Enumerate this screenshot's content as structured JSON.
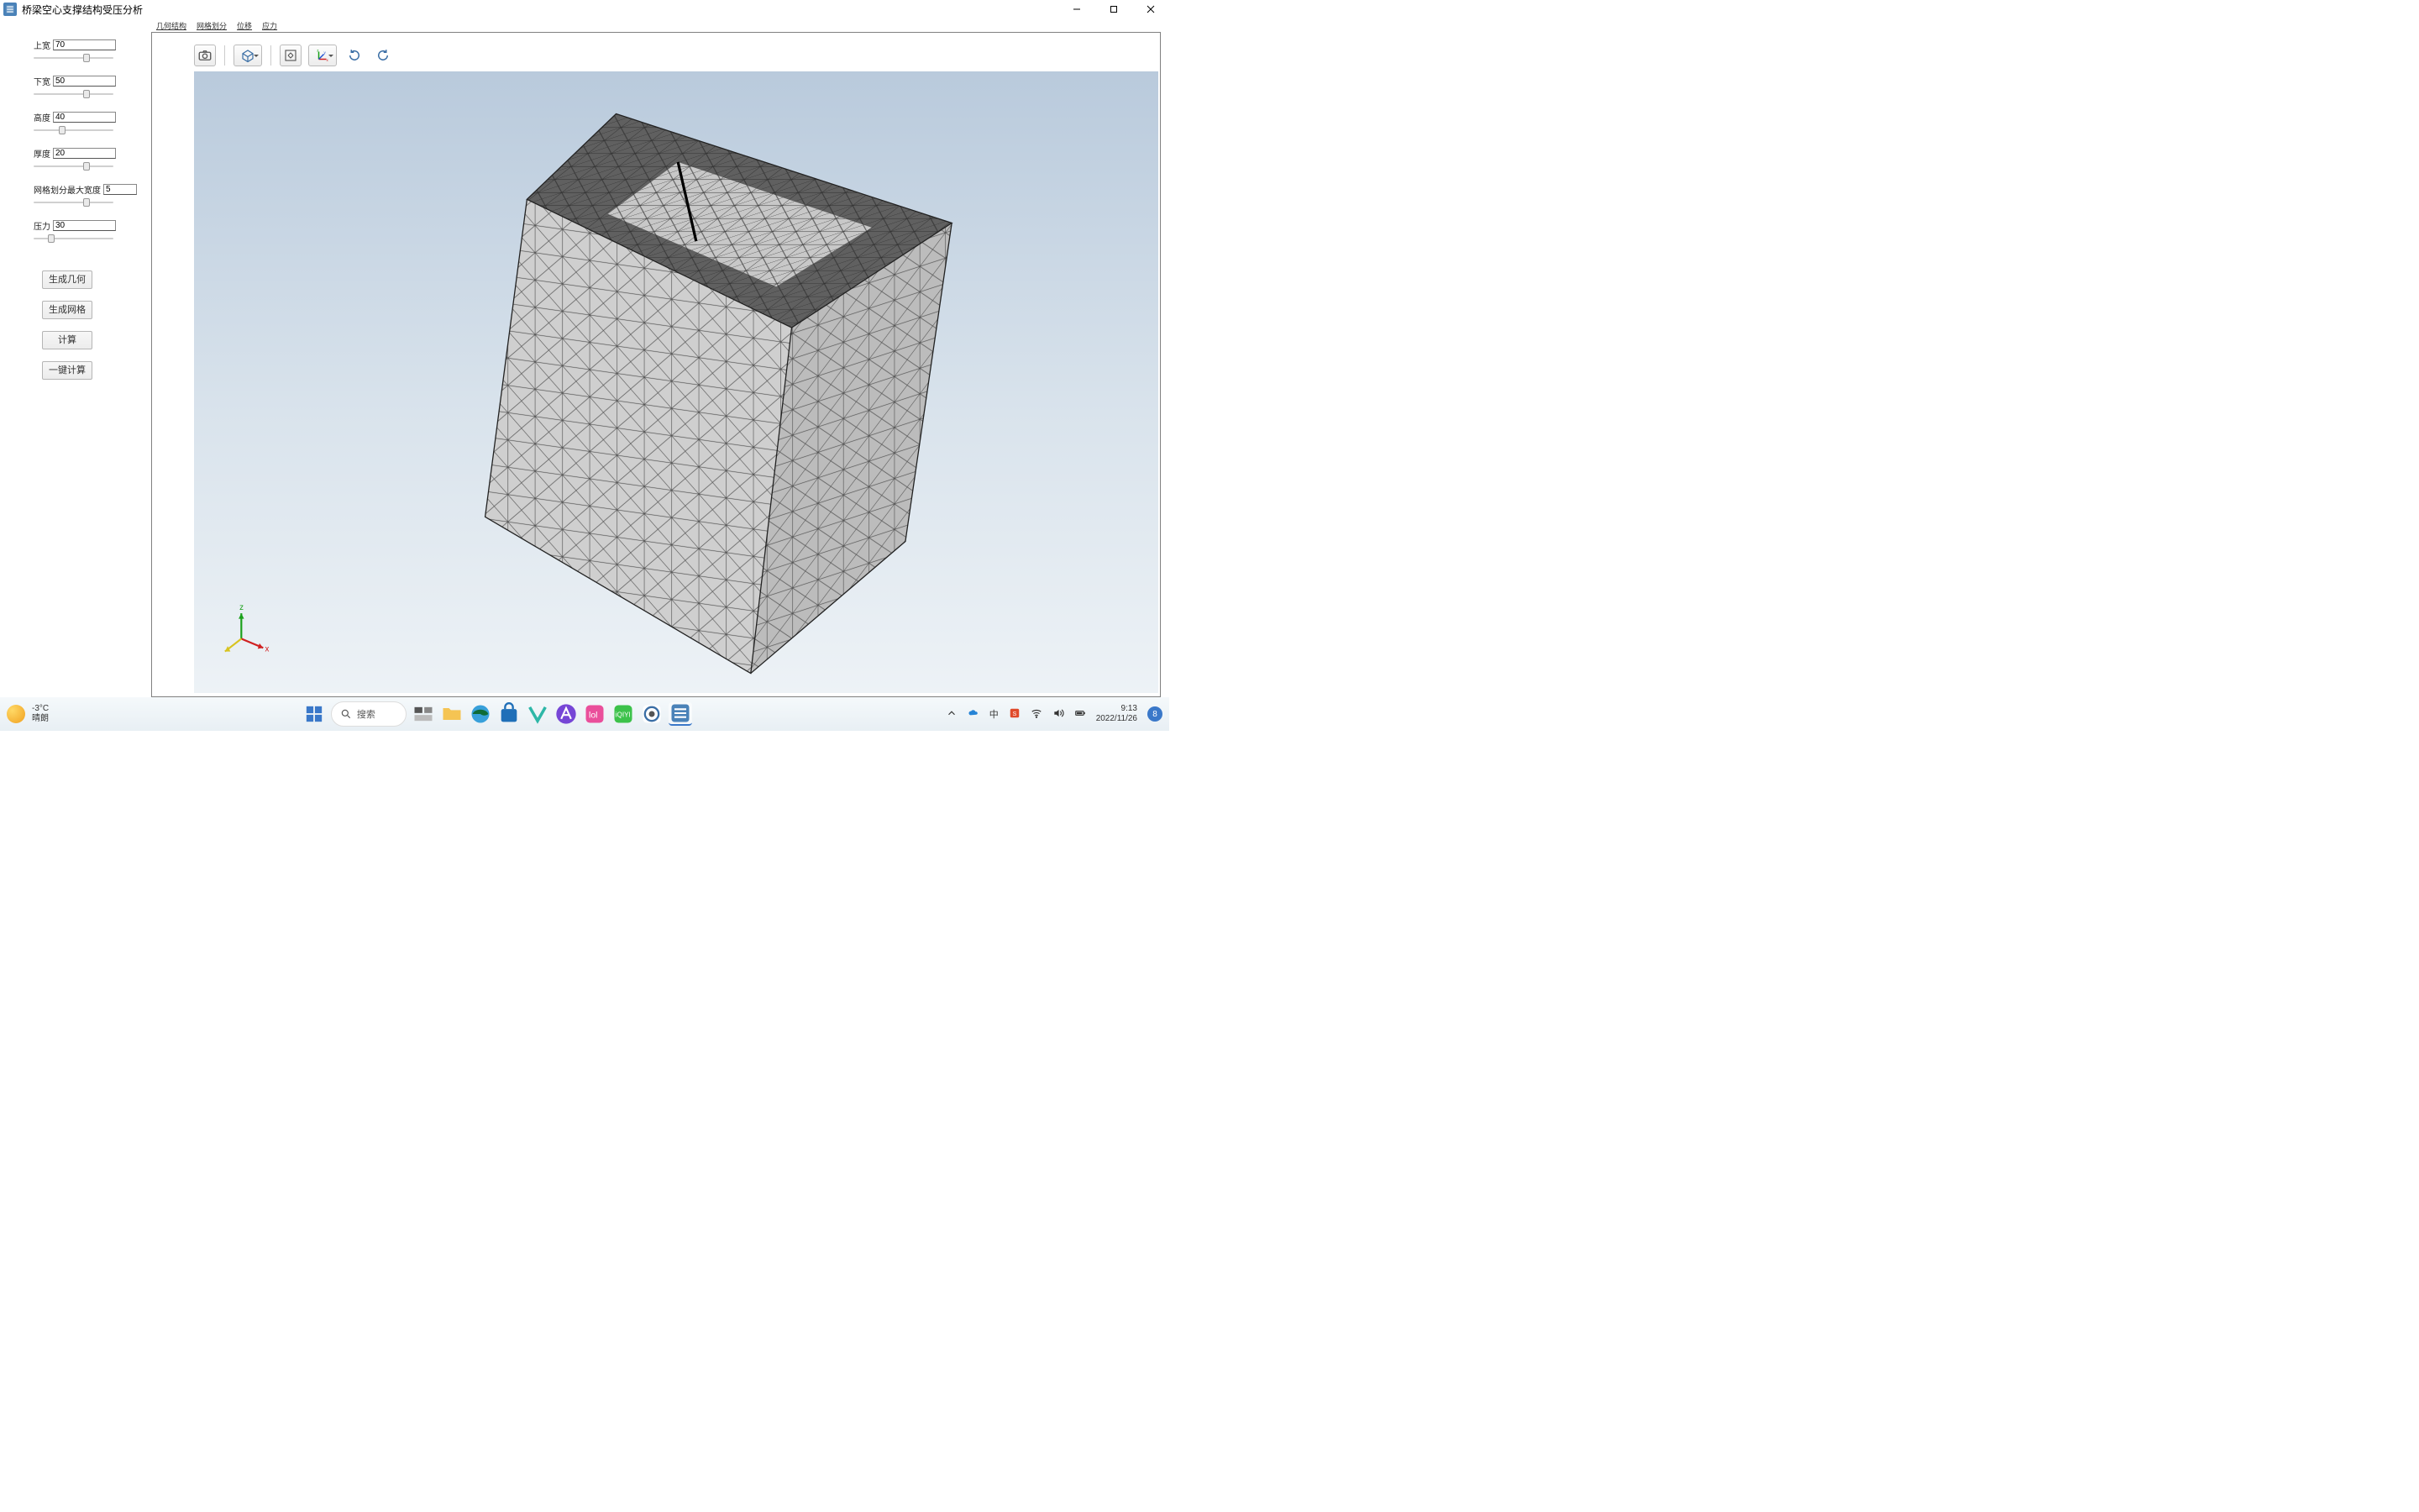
{
  "window": {
    "title": "桥梁空心支撑结构受压分析"
  },
  "sidebar": {
    "params": {
      "upper_width": {
        "label": "上宽",
        "value": "70",
        "thumb_pct": 62
      },
      "lower_width": {
        "label": "下宽",
        "value": "50",
        "thumb_pct": 62
      },
      "height": {
        "label": "高度",
        "value": "40",
        "thumb_pct": 32
      },
      "thickness": {
        "label": "厚度",
        "value": "20",
        "thumb_pct": 62
      },
      "mesh_max": {
        "label": "网格划分最大宽度",
        "value": "5",
        "thumb_pct": 62
      },
      "pressure": {
        "label": "压力",
        "value": "30",
        "thumb_pct": 18
      }
    },
    "buttons": {
      "gen_geom": "生成几何",
      "gen_mesh": "生成网格",
      "compute": "计算",
      "one_click": "一键计算"
    }
  },
  "tabs": {
    "geometry": "几何结构",
    "mesh": "网格划分",
    "disp": "位移",
    "stress": "应力"
  },
  "taskbar": {
    "weather_temp": "-3°C",
    "weather_desc": "晴朗",
    "search_placeholder": "搜索",
    "ime_lang": "中",
    "time": "9:13",
    "date": "2022/11/26",
    "notif_count": "8"
  }
}
